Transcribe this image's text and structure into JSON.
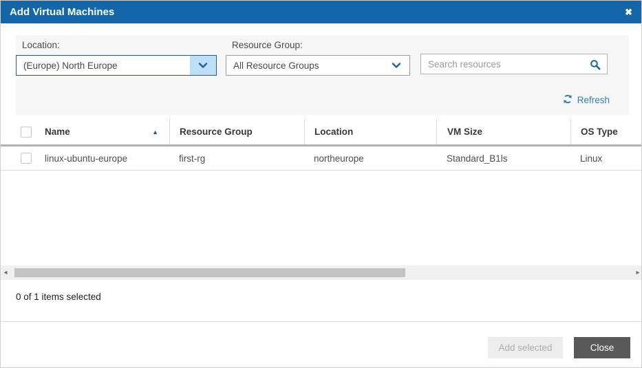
{
  "dialog": {
    "title": "Add Virtual Machines"
  },
  "filters": {
    "location": {
      "label": "Location:",
      "value": "(Europe) North Europe"
    },
    "resource_group": {
      "label": "Resource Group:",
      "value": "All Resource Groups"
    },
    "search": {
      "placeholder": "Search resources"
    },
    "refresh": {
      "label": "Refresh"
    }
  },
  "table": {
    "columns": {
      "name": "Name",
      "resource_group": "Resource Group",
      "location": "Location",
      "vm_size": "VM Size",
      "os_type": "OS Type"
    },
    "sort": {
      "column": "Name",
      "direction": "ascending"
    },
    "rows": [
      {
        "name": "linux-ubuntu-europe",
        "resource_group": "first-rg",
        "location": "northeurope",
        "vm_size": "Standard_B1ls",
        "os_type": "Linux",
        "selected": false
      }
    ]
  },
  "status": {
    "selection_summary": "0 of 1 items selected"
  },
  "footer": {
    "add_selected": "Add selected",
    "close": "Close"
  },
  "icons": {
    "close": "✖",
    "sort_ascending": "▲",
    "scroll_left": "◂",
    "scroll_right": "▸"
  },
  "colors": {
    "title_bar": "#1366a8",
    "link_blue": "#2e80ba",
    "chevron_blue": "#1d5fa5",
    "focused_control_bg": "#bee0f6",
    "focused_control_border": "#265a7e",
    "close_button_bg": "#595959"
  }
}
